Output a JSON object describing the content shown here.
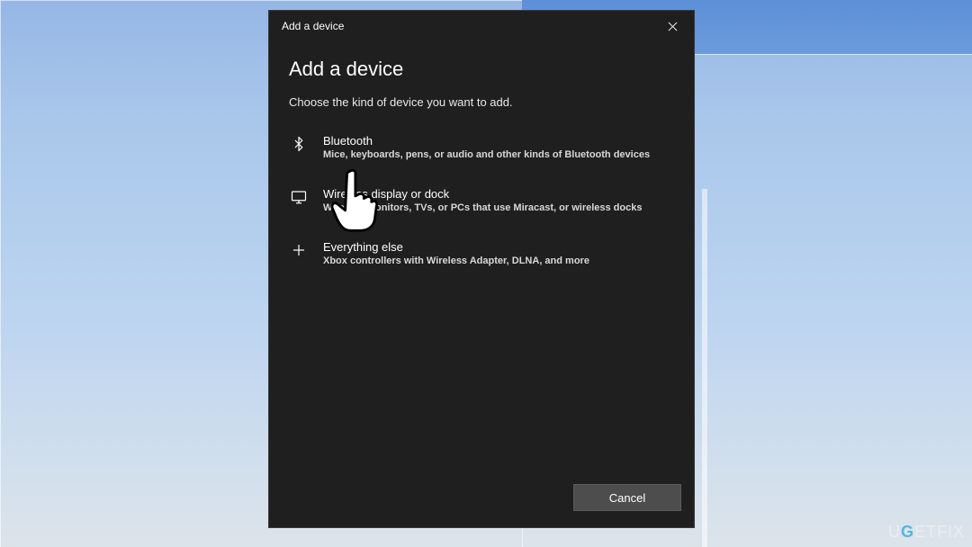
{
  "titlebar": {
    "text": "Add a device"
  },
  "dialog": {
    "heading": "Add a device",
    "subtitle": "Choose the kind of device you want to add."
  },
  "options": {
    "bluetooth": {
      "title": "Bluetooth",
      "desc": "Mice, keyboards, pens, or audio and other kinds of Bluetooth devices"
    },
    "wireless": {
      "title": "Wireless display or dock",
      "desc": "Wireless monitors, TVs, or PCs that use Miracast, or wireless docks"
    },
    "other": {
      "title": "Everything else",
      "desc": "Xbox controllers with Wireless Adapter, DLNA, and more"
    }
  },
  "footer": {
    "cancel": "Cancel"
  },
  "watermark": {
    "text": "U   FIX"
  }
}
